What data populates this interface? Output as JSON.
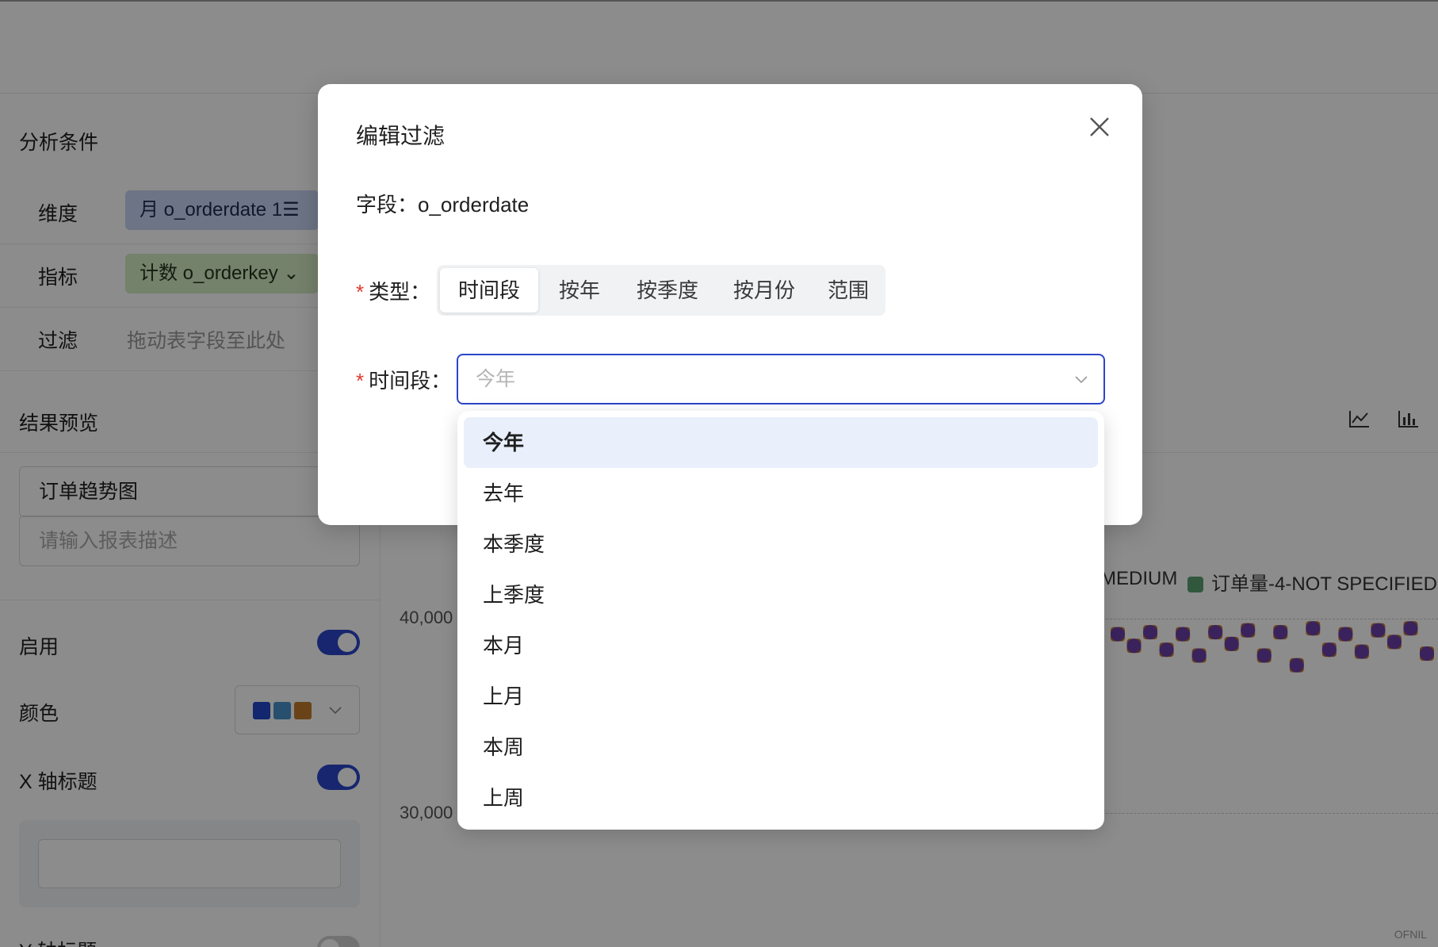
{
  "background": {
    "analysis": {
      "title": "分析条件",
      "rows": [
        {
          "label": "维度",
          "chip": "月 o_orderdate 1☰"
        },
        {
          "label": "指标",
          "chip": "计数 o_orderkey ⌄"
        },
        {
          "label": "过滤",
          "placeholder": "拖动表字段至此处"
        }
      ]
    },
    "preview": {
      "title": "结果预览",
      "report_name": "订单趋势图",
      "desc_placeholder": "请输入报表描述",
      "enable_label": "启用",
      "color_label": "颜色",
      "color_swatches": [
        "#2447c9",
        "#4a90c8",
        "#c07a2a"
      ],
      "x_title_label": "X 轴标题",
      "y_title_label": "Y 轴标题"
    },
    "chart": {
      "legend_left": "MEDIUM",
      "legend_right": "订单量-4-NOT SPECIFIED",
      "watermark": "OFNIL",
      "icons": [
        "line-chart-icon",
        "bar-chart-icon"
      ]
    }
  },
  "chart_data": {
    "type": "scatter",
    "title": "",
    "xlabel": "",
    "ylabel": "",
    "yticks": [
      "40,000",
      "30,000"
    ],
    "ylim": [
      25000,
      45000
    ],
    "series": [
      {
        "name": "订单量-4-NOT SPECIFIED",
        "values": [
          39200,
          38600,
          39300,
          38400,
          39200,
          38100,
          39300,
          38700,
          39400,
          38100,
          39300,
          37600,
          39500,
          38400,
          39200,
          38300,
          39400,
          38800,
          39500,
          38200
        ]
      }
    ]
  },
  "modal": {
    "title": "编辑过滤",
    "field_text": "字段：o_orderdate",
    "type_label": "类型：",
    "type_tabs": [
      "时间段",
      "按年",
      "按季度",
      "按月份",
      "范围"
    ],
    "active_tab": "时间段",
    "period_label": "时间段：",
    "period_placeholder": "今年",
    "required_mark": "*"
  },
  "dropdown": {
    "options": [
      "今年",
      "去年",
      "本季度",
      "上季度",
      "本月",
      "上月",
      "本周",
      "上周"
    ],
    "selected": "今年"
  }
}
